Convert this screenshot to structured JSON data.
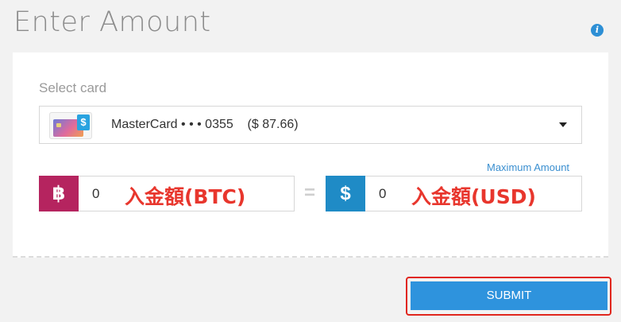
{
  "page": {
    "title": "Enter Amount",
    "info_icon": "info-icon"
  },
  "card_select": {
    "label": "Select card",
    "selected": "MasterCard • • • 0355    ($ 87.66)"
  },
  "amounts": {
    "max_label": "Maximum Amount",
    "btc": {
      "symbol": "฿",
      "value": "0",
      "annotation": "入金額(BTC)"
    },
    "equals": "=",
    "usd": {
      "symbol": "$",
      "value": "0",
      "annotation": "入金額(USD)"
    }
  },
  "submit": {
    "label": "SUBMIT"
  },
  "colors": {
    "btc_badge": "#b5245f",
    "usd_badge": "#1f8bc6",
    "submit": "#2e93dd",
    "highlight": "#e0261d",
    "annotation": "#e8362d"
  }
}
